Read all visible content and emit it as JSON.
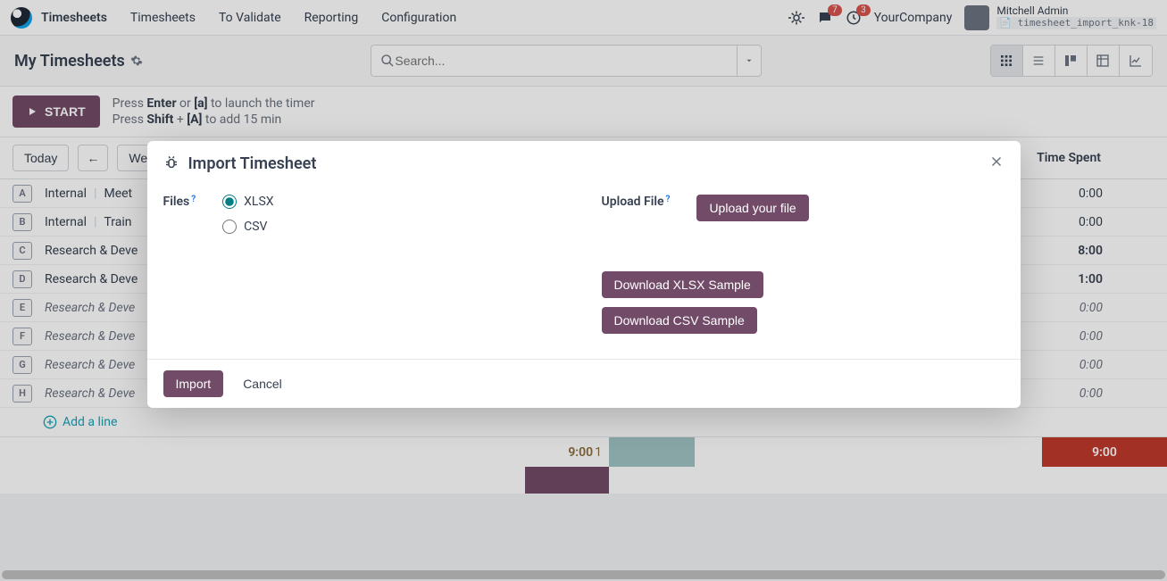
{
  "app": {
    "name": "Timesheets"
  },
  "nav": {
    "items": [
      "Timesheets",
      "To Validate",
      "Reporting",
      "Configuration"
    ]
  },
  "topnav": {
    "chat_badge": "7",
    "activity_badge": "3",
    "company": "YourCompany",
    "user_name": "Mitchell Admin",
    "db_name": "timesheet_import_knk-18"
  },
  "page": {
    "title": "My Timesheets"
  },
  "search": {
    "placeholder": "Search..."
  },
  "timer": {
    "start": "START",
    "hint1_prefix": "Press ",
    "hint1_key1": "Enter",
    "hint1_mid": " or ",
    "hint1_key2": "[a]",
    "hint1_suffix": " to launch the timer",
    "hint2_prefix": "Press ",
    "hint2_key1": "Shift",
    "hint2_mid": " + ",
    "hint2_key2": "[A]",
    "hint2_suffix": " to add 15 min"
  },
  "toolbar": {
    "today": "Today",
    "range_label": "Week",
    "time_spent_header": "Time Spent"
  },
  "rows": [
    {
      "key": "A",
      "project": "Internal",
      "task": "Meet",
      "time": "0:00",
      "italic": false
    },
    {
      "key": "B",
      "project": "Internal",
      "task": "Train",
      "time": "0:00",
      "italic": false
    },
    {
      "key": "C",
      "project": "Research & Deve",
      "task": "",
      "time": "8:00",
      "italic": false,
      "bold": true
    },
    {
      "key": "D",
      "project": "Research & Deve",
      "task": "",
      "time": "1:00",
      "italic": false,
      "bold": true
    },
    {
      "key": "E",
      "project": "Research & Deve",
      "task": "",
      "time": "0:00",
      "italic": true
    },
    {
      "key": "F",
      "project": "Research & Deve",
      "task": "",
      "time": "0:00",
      "italic": true
    },
    {
      "key": "G",
      "project": "Research & Deve",
      "task": "",
      "time": "0:00",
      "italic": true
    },
    {
      "key": "H",
      "project": "Research & Deve",
      "task": "",
      "time": "0:00",
      "italic": true
    }
  ],
  "add_line": "Add a line",
  "footer": {
    "done": "9:00",
    "remain": "1",
    "total": "9:00"
  },
  "modal": {
    "title": "Import Timesheet",
    "files_label": "Files",
    "option_xlsx": "XLSX",
    "option_csv": "CSV",
    "upload_label": "Upload File",
    "upload_btn": "Upload your file",
    "download_xlsx": "Download XLSX Sample",
    "download_csv": "Download CSV Sample",
    "import_btn": "Import",
    "cancel_btn": "Cancel"
  }
}
